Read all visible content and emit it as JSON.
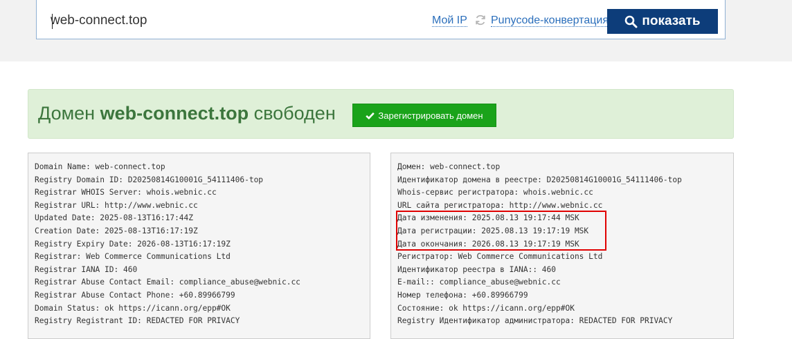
{
  "search": {
    "value": "web-connect.top",
    "myip_label": "Мой IP",
    "punycode_label": "Punycode-конвертация",
    "show_label": "показать"
  },
  "status": {
    "prefix": "Домен ",
    "domain": "web-connect.top",
    "suffix": " свободен",
    "register_label": "Зарегистрировать домен"
  },
  "whois_en": [
    "Domain Name: web-connect.top",
    "Registry Domain ID: D20250814G10001G_54111406-top",
    "Registrar WHOIS Server: whois.webnic.cc",
    "Registrar URL: http://www.webnic.cc",
    "Updated Date: 2025-08-13T16:17:44Z",
    "Creation Date: 2025-08-13T16:17:19Z",
    "Registry Expiry Date: 2026-08-13T16:17:19Z",
    "Registrar: Web Commerce Communications Ltd",
    "Registrar IANA ID: 460",
    "Registrar Abuse Contact Email: compliance_abuse@webnic.cc",
    "Registrar Abuse Contact Phone: +60.89966799",
    "Domain Status: ok https://icann.org/epp#OK",
    "Registry Registrant ID: REDACTED FOR PRIVACY"
  ],
  "whois_ru": [
    "Домен: web-connect.top",
    "Идентификатор домена в реестре: D20250814G10001G_54111406-top",
    "Whois-сервис регистратора: whois.webnic.cc",
    "URL сайта регистратора: http://www.webnic.cc",
    "Дата изменения: 2025.08.13 19:17:44 MSK",
    "Дата регистрации: 2025.08.13 19:17:19 MSK",
    "Дата окончания: 2026.08.13 19:17:19 MSK",
    "Регистратор: Web Commerce Communications Ltd",
    "Идентификатор реестра в IANA:: 460",
    "E-mail:: compliance_abuse@webnic.cc",
    "Номер телефона: +60.89966799",
    "Состояние: ok https://icann.org/epp#OK",
    "Registry Идентификатор администратора: REDACTED FOR PRIVACY"
  ],
  "colors": {
    "accent": "#0d3d7a",
    "link": "#2a6ebb",
    "success_bg": "#dff0d8",
    "success_text": "#3c763d",
    "register_button": "#1aa31a",
    "highlight": "#e00000"
  }
}
